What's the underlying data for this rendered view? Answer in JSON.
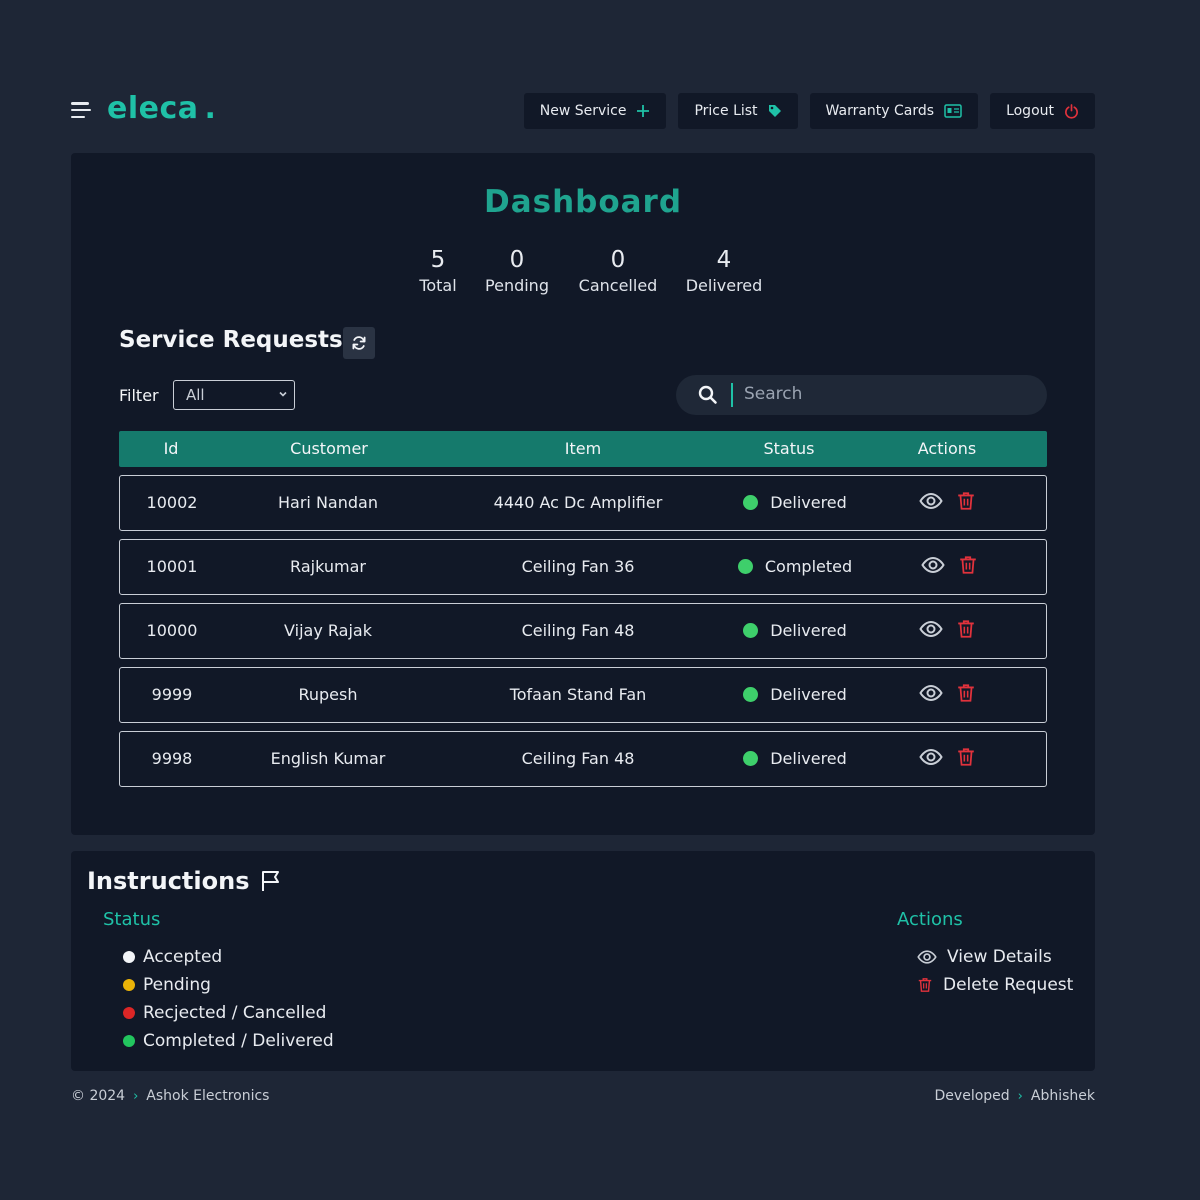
{
  "brand": {
    "name": "eleca",
    "dot": "."
  },
  "nav": {
    "new_service": "New Service",
    "price_list": "Price List",
    "warranty_cards": "Warranty Cards",
    "logout": "Logout"
  },
  "dashboard": {
    "title": "Dashboard",
    "stats": [
      {
        "value": "5",
        "label": "Total"
      },
      {
        "value": "0",
        "label": "Pending"
      },
      {
        "value": "0",
        "label": "Cancelled"
      },
      {
        "value": "4",
        "label": "Delivered"
      }
    ]
  },
  "requests": {
    "title": "Service Requests",
    "filter_label": "Filter",
    "filter_value": "All",
    "search_placeholder": "Search",
    "columns": [
      "Id",
      "Customer",
      "Item",
      "Status",
      "Actions"
    ],
    "rows": [
      {
        "id": "10002",
        "customer": "Hari Nandan",
        "item": "4440 Ac Dc Amplifier",
        "status": "Delivered"
      },
      {
        "id": "10001",
        "customer": "Rajkumar",
        "item": "Ceiling Fan 36",
        "status": "Completed"
      },
      {
        "id": "10000",
        "customer": "Vijay Rajak",
        "item": "Ceiling Fan 48",
        "status": "Delivered"
      },
      {
        "id": "9999",
        "customer": "Rupesh",
        "item": "Tofaan Stand Fan",
        "status": "Delivered"
      },
      {
        "id": "9998",
        "customer": "English Kumar",
        "item": "Ceiling Fan 48",
        "status": "Delivered"
      }
    ]
  },
  "instructions": {
    "title": "Instructions",
    "status_heading": "Status",
    "status_items": [
      {
        "label": "Accepted",
        "color": "#f3f5f8"
      },
      {
        "label": "Pending",
        "color": "#eab308"
      },
      {
        "label": "Recjected / Cancelled",
        "color": "#dc2626"
      },
      {
        "label": "Completed / Delivered",
        "color": "#22c55e"
      }
    ],
    "actions_heading": "Actions",
    "actions_items": [
      {
        "label": "View Details",
        "icon": "eye-icon"
      },
      {
        "label": "Delete Request",
        "icon": "trash-icon"
      }
    ]
  },
  "footer": {
    "copyright": "© 2024",
    "company": "Ashok Electronics",
    "developed": "Developed",
    "developer": "Abhishek"
  },
  "colors": {
    "accent": "#1fc1a7",
    "header": "#157a6c",
    "delete": "#e1323c",
    "status_green": "#3ecf6b"
  }
}
